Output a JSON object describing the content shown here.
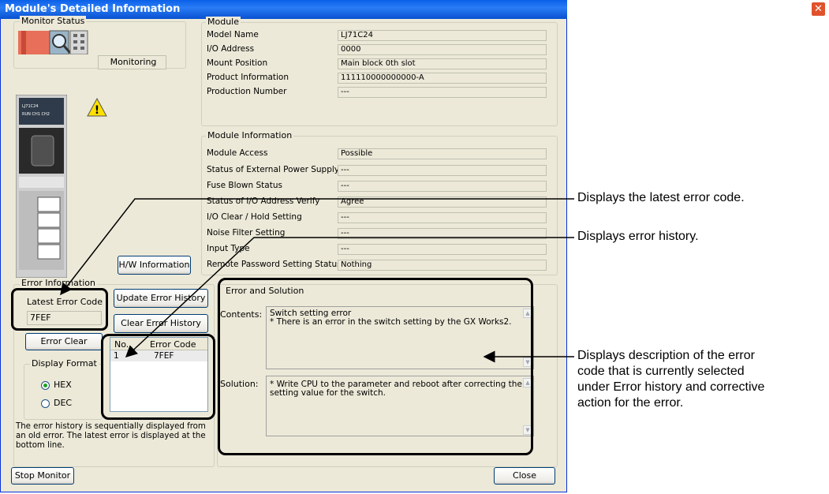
{
  "window": {
    "title": "Module's Detailed Information",
    "close_glyph": "✕"
  },
  "monitor": {
    "group_label": "Monitor Status",
    "status_text": "Monitoring"
  },
  "module": {
    "group_label": "Module",
    "rows": [
      {
        "label": "Model Name",
        "value": "LJ71C24"
      },
      {
        "label": "I/O Address",
        "value": "0000"
      },
      {
        "label": "Mount Position",
        "value": "Main block 0th slot"
      },
      {
        "label": "Product Information",
        "value": "111110000000000-A"
      },
      {
        "label": "Production Number",
        "value": "---"
      }
    ]
  },
  "module_info": {
    "group_label": "Module Information",
    "rows": [
      {
        "label": "Module Access",
        "value": "Possible"
      },
      {
        "label": "Status of External Power Supply",
        "value": "---"
      },
      {
        "label": "Fuse Blown Status",
        "value": "---"
      },
      {
        "label": "Status of I/O Address Verify",
        "value": "Agree"
      },
      {
        "label": "I/O Clear / Hold Setting",
        "value": "---"
      },
      {
        "label": "Noise Filter Setting",
        "value": "---"
      },
      {
        "label": "Input Type",
        "value": "---"
      },
      {
        "label": "Remote Password Setting Status",
        "value": "Nothing"
      }
    ]
  },
  "hw_button": "H/W Information",
  "error_info": {
    "group_label": "Error Information",
    "latest_label": "Latest Error Code",
    "latest_value": "7FEF",
    "update_history_button": "Update Error History",
    "clear_history_button": "Clear Error History",
    "error_clear_button": "Error Clear",
    "history_headers": [
      "No.",
      "Error Code"
    ],
    "history_rows": [
      {
        "no": "1",
        "code": "7FEF"
      }
    ],
    "display_format_label": "Display Format",
    "hex_label": "HEX",
    "dec_label": "DEC",
    "selected_format": "HEX",
    "note": "The error history is sequentially displayed from an old error. The latest error is displayed at the bottom line."
  },
  "solution": {
    "group_label": "Error and Solution",
    "contents_label": "Contents:",
    "contents_text_1": "Switch setting error",
    "contents_text_2": "* There is an error in the switch setting by the GX Works2.",
    "solution_label": "Solution:",
    "solution_text_1": "* Write CPU to the parameter and reboot after correcting the",
    "solution_text_2": "setting value for the switch."
  },
  "footer": {
    "stop_button": "Stop Monitor",
    "close_button": "Close"
  },
  "annotations": {
    "latest_error": "Displays the latest error code.",
    "history": "Displays error history.",
    "description_1": "Displays description of the error",
    "description_2": "code that is currently selected",
    "description_3": "under Error history and corrective",
    "description_4": "action for the error."
  }
}
